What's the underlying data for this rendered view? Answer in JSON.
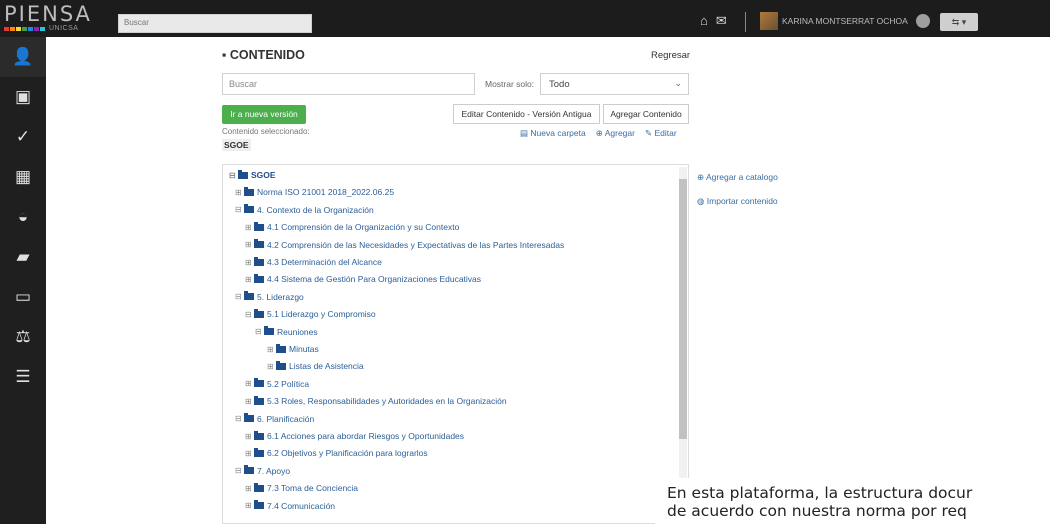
{
  "brand": {
    "title": "PIENSA",
    "subtitle": "UNICSA",
    "colors": [
      "#e53935",
      "#fb8c00",
      "#fdd835",
      "#43a047",
      "#1e88e5",
      "#8e24aa",
      "#26c6da"
    ]
  },
  "topbar": {
    "search_placeholder": "Buscar",
    "user_name": "KARINA MONTSERRAT OCHOA",
    "lang_label": "⇆ ▾"
  },
  "sidebar": {
    "items": [
      "person-icon",
      "note-icon",
      "check-icon",
      "calendar-icon",
      "inbox-icon",
      "book-icon",
      "laptop-icon",
      "scale-icon",
      "list-icon"
    ]
  },
  "content": {
    "title": "CONTENIDO",
    "back": "Regresar",
    "search_placeholder": "Buscar",
    "filter_label": "Mostrar solo:",
    "filter_value": "Todo",
    "new_version": "Ir a nueva versión",
    "edit_old": "Editar Contenido - Versión Antigua",
    "add_content": "Agregar Contenido",
    "selected_label": "Contenido seleccionado:",
    "selected_value": "SGOE",
    "new_folder": "Nueva carpeta",
    "add": "Agregar",
    "edit": "Editar"
  },
  "tree": [
    {
      "label": "SGOE",
      "level": 0,
      "exp": "⊟"
    },
    {
      "label": "Norma ISO 21001 2018_2022.06.25",
      "level": 1,
      "exp": "⊞"
    },
    {
      "label": "4. Contexto de la Organización",
      "level": 1,
      "exp": "⊟"
    },
    {
      "label": "4.1 Comprensión de la Organización y su Contexto",
      "level": 2,
      "exp": "⊞"
    },
    {
      "label": "4.2 Comprensión de las Necesidades y Expectativas de las Partes Interesadas",
      "level": 2,
      "exp": "⊞"
    },
    {
      "label": "4.3 Determinación del Alcance",
      "level": 2,
      "exp": "⊞"
    },
    {
      "label": "4.4 Sistema de Gestión Para Organizaciones Educativas",
      "level": 2,
      "exp": "⊞"
    },
    {
      "label": "5. Liderazgo",
      "level": 1,
      "exp": "⊟"
    },
    {
      "label": "5.1 Liderazgo y Compromiso",
      "level": 2,
      "exp": "⊟"
    },
    {
      "label": "Reuniones",
      "level": 3,
      "exp": "⊟"
    },
    {
      "label": "Minutas",
      "level": 4,
      "exp": "⊞"
    },
    {
      "label": "Listas de Asistencia",
      "level": 4,
      "exp": "⊞"
    },
    {
      "label": "5.2 Política",
      "level": 2,
      "exp": "⊞"
    },
    {
      "label": "5.3 Roles, Responsabilidades y Autoridades en la Organización",
      "level": 2,
      "exp": "⊞"
    },
    {
      "label": "6. Planificación",
      "level": 1,
      "exp": "⊟"
    },
    {
      "label": "6.1 Acciones para abordar Riesgos y Oportunidades",
      "level": 2,
      "exp": "⊞"
    },
    {
      "label": "6.2 Objetivos y Planificación para lograrlos",
      "level": 2,
      "exp": "⊞"
    },
    {
      "label": "7. Apoyo",
      "level": 1,
      "exp": "⊟"
    },
    {
      "label": "7.3 Toma de Conciencia",
      "level": 2,
      "exp": "⊞"
    },
    {
      "label": "7.4 Comunicación",
      "level": 2,
      "exp": "⊞"
    }
  ],
  "right_links": {
    "add_catalog": "Agregar a catalogo",
    "import": "Importar contenido"
  },
  "caption": {
    "line1": "En esta plataforma, la estructura docur",
    "line2": "de acuerdo con nuestra norma por req"
  }
}
